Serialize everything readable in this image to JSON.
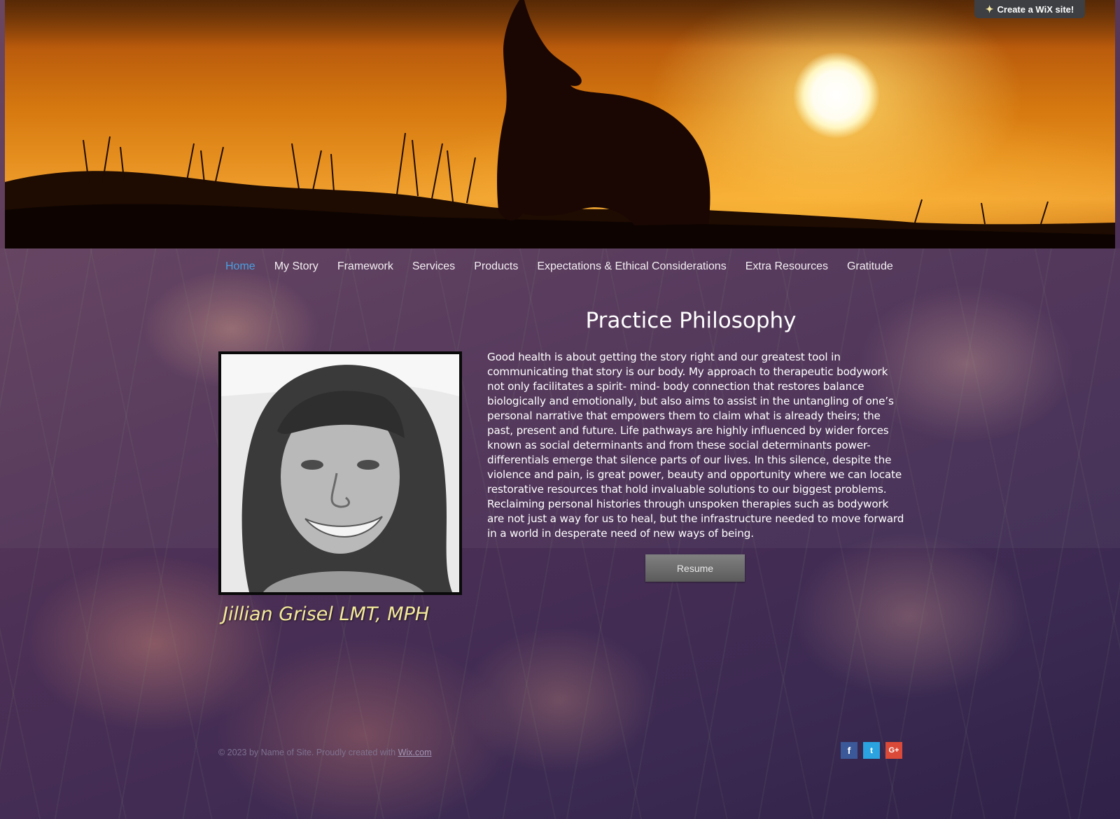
{
  "banner": {
    "wix_badge_label": "Create a WiX site!",
    "wix_badge_icon": "wix-star-icon"
  },
  "nav": {
    "items": [
      {
        "label": "Home",
        "active": true
      },
      {
        "label": "My Story"
      },
      {
        "label": "Framework"
      },
      {
        "label": "Services"
      },
      {
        "label": "Products"
      },
      {
        "label": "Expectations & Ethical Considerations"
      },
      {
        "label": "Extra Resources"
      },
      {
        "label": "Gratitude"
      }
    ]
  },
  "main": {
    "title": "Practice Philosophy",
    "paragraph": "Good health is about getting the story right and our greatest tool in communicating that story is our body. My approach to therapeutic bodywork not only facilitates a spirit- mind- body connection that restores balance biologically and emotionally, but also aims to assist in the untangling of one’s personal narrative that empowers them to claim what is already theirs; the past, present and future. Life pathways are highly influenced by wider forces known as social determinants and from these social determinants power-differentials emerge that silence parts of our lives.  In this silence, despite the violence and pain, is great power, beauty and opportunity where we can locate restorative resources that hold invaluable solutions to our biggest problems. Reclaiming personal histories through unspoken therapies such as bodywork are not just a way for us to heal, but the infrastructure needed to move forward in a world in desperate need of new ways of being.",
    "resume_label": "Resume",
    "name": "Jillian Grisel LMT, MPH"
  },
  "footer": {
    "copyright": "© 2023 by Name of Site. Proudly created with ",
    "link_label": "Wix.com"
  },
  "social": {
    "facebook": "f",
    "twitter": "t",
    "googleplus": "G+"
  },
  "colors": {
    "nav_active": "#4a9fe0",
    "name_text": "#f4ea9a",
    "facebook": "#3b5998",
    "twitter": "#2aa3e0",
    "googleplus": "#db4a39"
  }
}
